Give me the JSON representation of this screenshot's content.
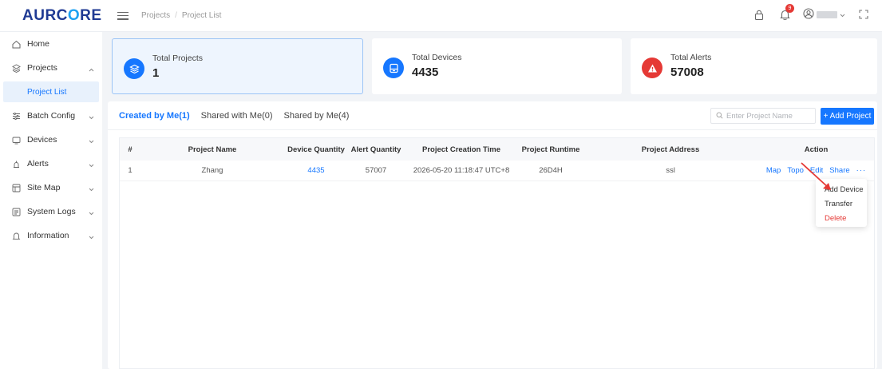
{
  "brand": {
    "logo_prefix": "AURC",
    "logo_o": "O",
    "logo_suffix": "RE"
  },
  "breadcrumb": [
    "Projects",
    "Project List"
  ],
  "notifications": {
    "count": "9"
  },
  "sidebar": {
    "items": [
      {
        "label": "Home",
        "icon": "home-icon"
      },
      {
        "label": "Projects",
        "icon": "layers-icon",
        "expanded": true
      },
      {
        "label": "Project List",
        "active": true
      },
      {
        "label": "Batch Config",
        "icon": "sliders-icon"
      },
      {
        "label": "Devices",
        "icon": "monitor-icon"
      },
      {
        "label": "Alerts",
        "icon": "alert-icon"
      },
      {
        "label": "Site Map",
        "icon": "map-icon"
      },
      {
        "label": "System Logs",
        "icon": "logs-icon"
      },
      {
        "label": "Information",
        "icon": "bell-icon"
      }
    ]
  },
  "stats": [
    {
      "title": "Total Projects",
      "value": "1",
      "color": "#1677ff"
    },
    {
      "title": "Total Devices",
      "value": "4435",
      "color": "#1677ff"
    },
    {
      "title": "Total Alerts",
      "value": "57008",
      "color": "#e53935"
    }
  ],
  "tabs": [
    {
      "label": "Created by Me(1)",
      "active": true
    },
    {
      "label": "Shared with Me(0)"
    },
    {
      "label": "Shared by Me(4)"
    }
  ],
  "search": {
    "placeholder": "Enter Project Name"
  },
  "add_button": "+ Add Project",
  "table": {
    "headers": [
      "#",
      "Project Name",
      "Device Quantity",
      "Alert Quantity",
      "Project Creation Time",
      "Project Runtime",
      "Project Address",
      "Action"
    ],
    "rows": [
      {
        "index": "1",
        "name": "Zhang",
        "devices": "4435",
        "alerts": "57007",
        "created": "2026-05-20 11:18:47 UTC+8",
        "runtime": "26D4H",
        "address": "ssl"
      }
    ],
    "actions": [
      "Map",
      "Topo",
      "Edit",
      "Share",
      "···"
    ]
  },
  "more_menu": [
    "Add Device",
    "Transfer",
    "Delete"
  ],
  "colors": {
    "accent": "#1677ff",
    "danger": "#e53935"
  }
}
